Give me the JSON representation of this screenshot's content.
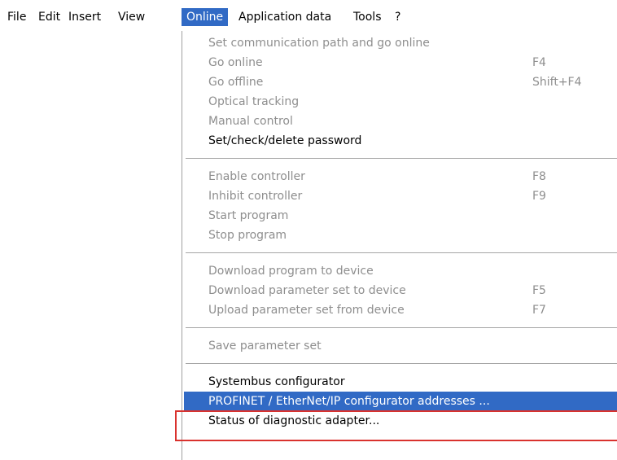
{
  "menubar": {
    "items": [
      "File",
      "Edit",
      "Insert",
      "View",
      "Online",
      "Application data",
      "Tools",
      "?"
    ],
    "active": "Online"
  },
  "menu": {
    "groups": [
      [
        {
          "label": "Set communication path and go online",
          "shortcut": "",
          "enabled": false
        },
        {
          "label": "Go online",
          "shortcut": "F4",
          "enabled": false
        },
        {
          "label": "Go offline",
          "shortcut": "Shift+F4",
          "enabled": false
        },
        {
          "label": "Optical tracking",
          "shortcut": "",
          "enabled": false
        },
        {
          "label": "Manual control",
          "shortcut": "",
          "enabled": false
        },
        {
          "label": "Set/check/delete password",
          "shortcut": "",
          "enabled": true
        }
      ],
      [
        {
          "label": "Enable controller",
          "shortcut": "F8",
          "enabled": false
        },
        {
          "label": "Inhibit controller",
          "shortcut": "F9",
          "enabled": false
        },
        {
          "label": "Start program",
          "shortcut": "",
          "enabled": false
        },
        {
          "label": "Stop program",
          "shortcut": "",
          "enabled": false
        }
      ],
      [
        {
          "label": "Download program to device",
          "shortcut": "",
          "enabled": false
        },
        {
          "label": "Download parameter set to device",
          "shortcut": "F5",
          "enabled": false
        },
        {
          "label": "Upload parameter set from device",
          "shortcut": "F7",
          "enabled": false
        }
      ],
      [
        {
          "label": "Save parameter set",
          "shortcut": "",
          "enabled": false
        }
      ],
      [
        {
          "label": "Systembus configurator",
          "shortcut": "",
          "enabled": true
        },
        {
          "label": "PROFINET / EtherNet/IP configurator addresses ...",
          "shortcut": "",
          "enabled": true,
          "highlighted": true
        },
        {
          "label": "Status of diagnostic adapter...",
          "shortcut": "",
          "enabled": true
        }
      ]
    ]
  },
  "colors": {
    "highlight": "#316ac5",
    "disabled_text": "#8e8e8e",
    "annotation_box": "#d9322e"
  }
}
